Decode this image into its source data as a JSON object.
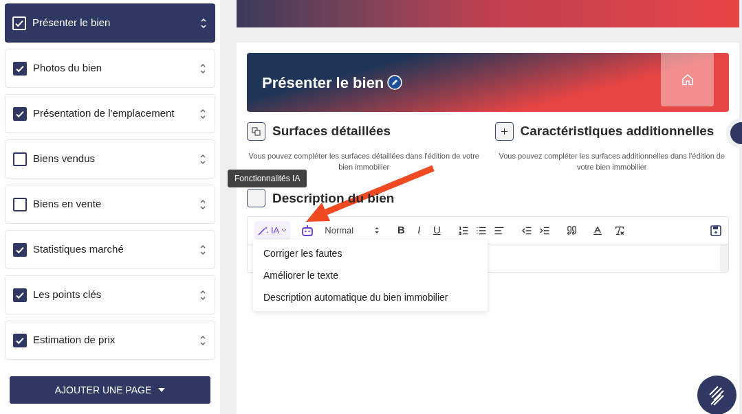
{
  "sidebar": {
    "items": [
      {
        "label": "Présenter le bien",
        "checked": true,
        "selected": true
      },
      {
        "label": "Photos du bien",
        "checked": true,
        "selected": false
      },
      {
        "label": "Présentation de l'emplacement",
        "checked": true,
        "selected": false
      },
      {
        "label": "Biens vendus",
        "checked": false,
        "selected": false
      },
      {
        "label": "Biens en vente",
        "checked": false,
        "selected": false
      },
      {
        "label": "Statistiques marché",
        "checked": true,
        "selected": false
      },
      {
        "label": "Les points clés",
        "checked": true,
        "selected": false
      },
      {
        "label": "Estimation de prix",
        "checked": true,
        "selected": false
      }
    ],
    "add_button": "AJOUTER UNE PAGE"
  },
  "banner": {
    "title": "Présenter le bien"
  },
  "sections": [
    {
      "title": "Surfaces détaillées",
      "kind": "copy",
      "text": "Vous pouvez compléter les surfaces détaillées dans l'édition de votre bien immobilier"
    },
    {
      "title": "Caractéristiques additionnelles",
      "kind": "plus",
      "text": "Vous pouvez compléter les surfaces additionnelles dans l'édition de votre bien immobilier"
    }
  ],
  "description": {
    "title": "Description du bien",
    "tooltip": "Fonctionnalités IA",
    "ia_button": "IA",
    "format": "Normal",
    "tools": [
      "B",
      "I",
      "U"
    ],
    "menu": [
      "Corriger les fautes",
      "Améliorer le texte",
      "Description automatique du bien immobilier"
    ]
  }
}
